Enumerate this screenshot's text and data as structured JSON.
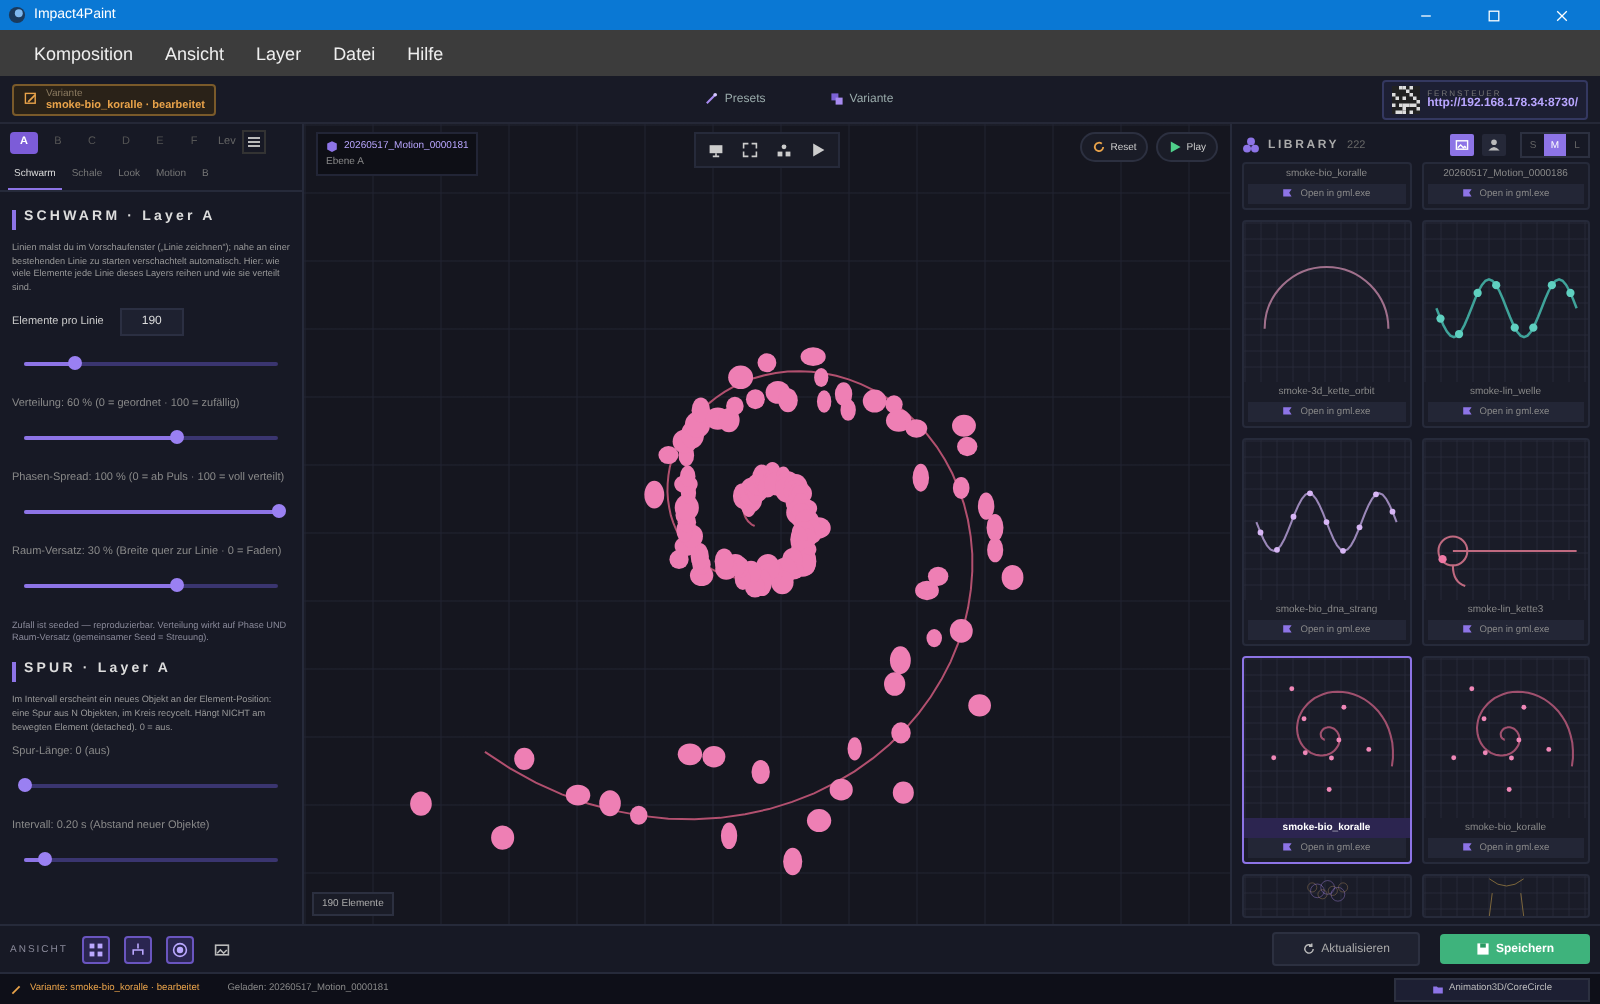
{
  "window": {
    "title": "Impact4Paint"
  },
  "menu": [
    "Komposition",
    "Ansicht",
    "Layer",
    "Datei",
    "Hilfe"
  ],
  "variant": {
    "label": "Variante",
    "text": "smoke-bio_koralle · bearbeitet"
  },
  "toolbar": [
    {
      "kind": "presets",
      "label": "Presets"
    },
    {
      "kind": "variant",
      "label": "Variante"
    }
  ],
  "remote": {
    "label": "FERNSTEUER",
    "url": "http://192.168.178.34:8730/"
  },
  "layers": {
    "tabs": [
      {
        "label": "A",
        "selected": true
      },
      {
        "label": "B",
        "selected": false
      },
      {
        "label": "C",
        "selected": false
      },
      {
        "label": "D",
        "selected": false
      },
      {
        "label": "E",
        "selected": false
      },
      {
        "label": "F",
        "selected": false
      }
    ],
    "more": "Lev"
  },
  "sections": [
    {
      "label": "Schwarm",
      "selected": true
    },
    {
      "label": "Schale",
      "selected": false
    },
    {
      "label": "Look",
      "selected": false
    },
    {
      "label": "Motion",
      "selected": false
    },
    {
      "label": "B",
      "selected": false
    }
  ],
  "schwarm": {
    "title": "SCHWARM · Layer A",
    "intro": "Linien malst du im Vorschaufenster („Linie zeichnen“); nahe an einer bestehenden Linie zu starten verschachtelt automatisch. Hier: wie viele Elemente jede Linie dieses Layers reihen und wie sie verteilt sind.",
    "controls": [
      {
        "kind": "number",
        "label": "Elemente pro Linie",
        "value": "190",
        "level": 0.2
      },
      {
        "kind": "slider",
        "label": "Verteilung: 60 %  (0 = geordnet · 100 = zufällig)",
        "level": 0.6
      },
      {
        "kind": "slider",
        "label": "Phasen-Spread: 100 %  (0 = ab Puls · 100 = voll verteilt)",
        "level": 1
      },
      {
        "kind": "slider",
        "label": "Raum-Versatz: 30 %  (Breite quer zur Linie · 0 = Faden)",
        "level": 0.6
      }
    ],
    "note": "Zufall ist seeded — reproduzierbar. Verteilung wirkt auf Phase UND Raum-Versatz (gemeinsamer Seed = Streuung)."
  },
  "spur": {
    "title": "SPUR · Layer A",
    "intro": "Im Intervall erscheint ein neues Objekt an der Element-Position: eine Spur aus N Objekten, im Kreis recycelt. Hängt NICHT am bewegten Element (detached). 0 = aus.",
    "controls": [
      {
        "kind": "slider",
        "label": "Spur-Länge: 0  (aus)",
        "level": 0
      },
      {
        "kind": "slider",
        "label": "Intervall: 0.20 s  (Abstand neuer Objekte)",
        "level": 0.08
      }
    ]
  },
  "canvas": {
    "project": "20260517_Motion_0000181",
    "layer": "Ebene A",
    "reset": "Reset",
    "play": "Play",
    "count": "190 Elemente"
  },
  "library": {
    "title": "LIBRARY",
    "count": "222",
    "views": [
      {
        "kind": "image",
        "selected": true
      },
      {
        "kind": "person",
        "selected": false
      }
    ],
    "sizes": [
      {
        "label": "S",
        "selected": false
      },
      {
        "label": "M",
        "selected": true
      },
      {
        "label": "L",
        "selected": false
      }
    ],
    "cards": [
      {
        "kind": "partial",
        "name": "smoke-bio_koralle",
        "action": "Open in gml.exe",
        "selected": false
      },
      {
        "kind": "partial",
        "name": "20260517_Motion_0000186",
        "action": "Open in gml.exe",
        "selected": false
      },
      {
        "kind": "arc",
        "name": "smoke-3d_kette_orbit",
        "action": "Open in gml.exe",
        "selected": false
      },
      {
        "kind": "wave",
        "name": "smoke-lin_welle",
        "action": "Open in gml.exe",
        "selected": false
      },
      {
        "kind": "dna",
        "name": "smoke-bio_dna_strang",
        "action": "Open in gml.exe",
        "selected": false
      },
      {
        "kind": "chain",
        "name": "smoke-lin_kette3",
        "action": "Open in gml.exe",
        "selected": false
      },
      {
        "kind": "spiral",
        "name": "smoke-bio_koralle",
        "action": "Open in gml.exe",
        "selected": true
      },
      {
        "kind": "spiral",
        "name": "smoke-bio_koralle",
        "action": "Open in gml.exe",
        "selected": false
      },
      {
        "kind": "tangle",
        "selected": false
      },
      {
        "kind": "curve",
        "selected": false
      }
    ]
  },
  "view_bar": {
    "label": "ANSICHT",
    "modes": [
      {
        "kind": "grid",
        "selected": true
      },
      {
        "kind": "tree",
        "selected": true
      },
      {
        "kind": "circle",
        "selected": true
      },
      {
        "kind": "image",
        "selected": false
      }
    ]
  },
  "actions": {
    "refresh": "Aktualisieren",
    "save": "Speichern"
  },
  "status": {
    "variant": "Variante: smoke-bio_koralle · bearbeitet",
    "loaded": "Geladen: 20260517_Motion_0000181",
    "path": "Animation3D/CoreCircle"
  }
}
